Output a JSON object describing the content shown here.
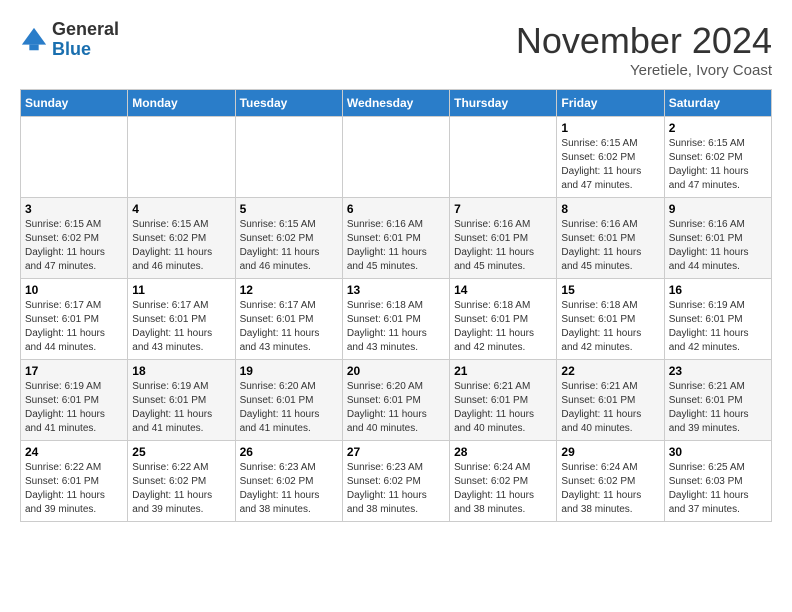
{
  "header": {
    "logo_general": "General",
    "logo_blue": "Blue",
    "month_title": "November 2024",
    "location": "Yeretiele, Ivory Coast"
  },
  "weekdays": [
    "Sunday",
    "Monday",
    "Tuesday",
    "Wednesday",
    "Thursday",
    "Friday",
    "Saturday"
  ],
  "weeks": [
    [
      {
        "day": "",
        "info": ""
      },
      {
        "day": "",
        "info": ""
      },
      {
        "day": "",
        "info": ""
      },
      {
        "day": "",
        "info": ""
      },
      {
        "day": "",
        "info": ""
      },
      {
        "day": "1",
        "info": "Sunrise: 6:15 AM\nSunset: 6:02 PM\nDaylight: 11 hours and 47 minutes."
      },
      {
        "day": "2",
        "info": "Sunrise: 6:15 AM\nSunset: 6:02 PM\nDaylight: 11 hours and 47 minutes."
      }
    ],
    [
      {
        "day": "3",
        "info": "Sunrise: 6:15 AM\nSunset: 6:02 PM\nDaylight: 11 hours and 47 minutes."
      },
      {
        "day": "4",
        "info": "Sunrise: 6:15 AM\nSunset: 6:02 PM\nDaylight: 11 hours and 46 minutes."
      },
      {
        "day": "5",
        "info": "Sunrise: 6:15 AM\nSunset: 6:02 PM\nDaylight: 11 hours and 46 minutes."
      },
      {
        "day": "6",
        "info": "Sunrise: 6:16 AM\nSunset: 6:01 PM\nDaylight: 11 hours and 45 minutes."
      },
      {
        "day": "7",
        "info": "Sunrise: 6:16 AM\nSunset: 6:01 PM\nDaylight: 11 hours and 45 minutes."
      },
      {
        "day": "8",
        "info": "Sunrise: 6:16 AM\nSunset: 6:01 PM\nDaylight: 11 hours and 45 minutes."
      },
      {
        "day": "9",
        "info": "Sunrise: 6:16 AM\nSunset: 6:01 PM\nDaylight: 11 hours and 44 minutes."
      }
    ],
    [
      {
        "day": "10",
        "info": "Sunrise: 6:17 AM\nSunset: 6:01 PM\nDaylight: 11 hours and 44 minutes."
      },
      {
        "day": "11",
        "info": "Sunrise: 6:17 AM\nSunset: 6:01 PM\nDaylight: 11 hours and 43 minutes."
      },
      {
        "day": "12",
        "info": "Sunrise: 6:17 AM\nSunset: 6:01 PM\nDaylight: 11 hours and 43 minutes."
      },
      {
        "day": "13",
        "info": "Sunrise: 6:18 AM\nSunset: 6:01 PM\nDaylight: 11 hours and 43 minutes."
      },
      {
        "day": "14",
        "info": "Sunrise: 6:18 AM\nSunset: 6:01 PM\nDaylight: 11 hours and 42 minutes."
      },
      {
        "day": "15",
        "info": "Sunrise: 6:18 AM\nSunset: 6:01 PM\nDaylight: 11 hours and 42 minutes."
      },
      {
        "day": "16",
        "info": "Sunrise: 6:19 AM\nSunset: 6:01 PM\nDaylight: 11 hours and 42 minutes."
      }
    ],
    [
      {
        "day": "17",
        "info": "Sunrise: 6:19 AM\nSunset: 6:01 PM\nDaylight: 11 hours and 41 minutes."
      },
      {
        "day": "18",
        "info": "Sunrise: 6:19 AM\nSunset: 6:01 PM\nDaylight: 11 hours and 41 minutes."
      },
      {
        "day": "19",
        "info": "Sunrise: 6:20 AM\nSunset: 6:01 PM\nDaylight: 11 hours and 41 minutes."
      },
      {
        "day": "20",
        "info": "Sunrise: 6:20 AM\nSunset: 6:01 PM\nDaylight: 11 hours and 40 minutes."
      },
      {
        "day": "21",
        "info": "Sunrise: 6:21 AM\nSunset: 6:01 PM\nDaylight: 11 hours and 40 minutes."
      },
      {
        "day": "22",
        "info": "Sunrise: 6:21 AM\nSunset: 6:01 PM\nDaylight: 11 hours and 40 minutes."
      },
      {
        "day": "23",
        "info": "Sunrise: 6:21 AM\nSunset: 6:01 PM\nDaylight: 11 hours and 39 minutes."
      }
    ],
    [
      {
        "day": "24",
        "info": "Sunrise: 6:22 AM\nSunset: 6:01 PM\nDaylight: 11 hours and 39 minutes."
      },
      {
        "day": "25",
        "info": "Sunrise: 6:22 AM\nSunset: 6:02 PM\nDaylight: 11 hours and 39 minutes."
      },
      {
        "day": "26",
        "info": "Sunrise: 6:23 AM\nSunset: 6:02 PM\nDaylight: 11 hours and 38 minutes."
      },
      {
        "day": "27",
        "info": "Sunrise: 6:23 AM\nSunset: 6:02 PM\nDaylight: 11 hours and 38 minutes."
      },
      {
        "day": "28",
        "info": "Sunrise: 6:24 AM\nSunset: 6:02 PM\nDaylight: 11 hours and 38 minutes."
      },
      {
        "day": "29",
        "info": "Sunrise: 6:24 AM\nSunset: 6:02 PM\nDaylight: 11 hours and 38 minutes."
      },
      {
        "day": "30",
        "info": "Sunrise: 6:25 AM\nSunset: 6:03 PM\nDaylight: 11 hours and 37 minutes."
      }
    ]
  ]
}
